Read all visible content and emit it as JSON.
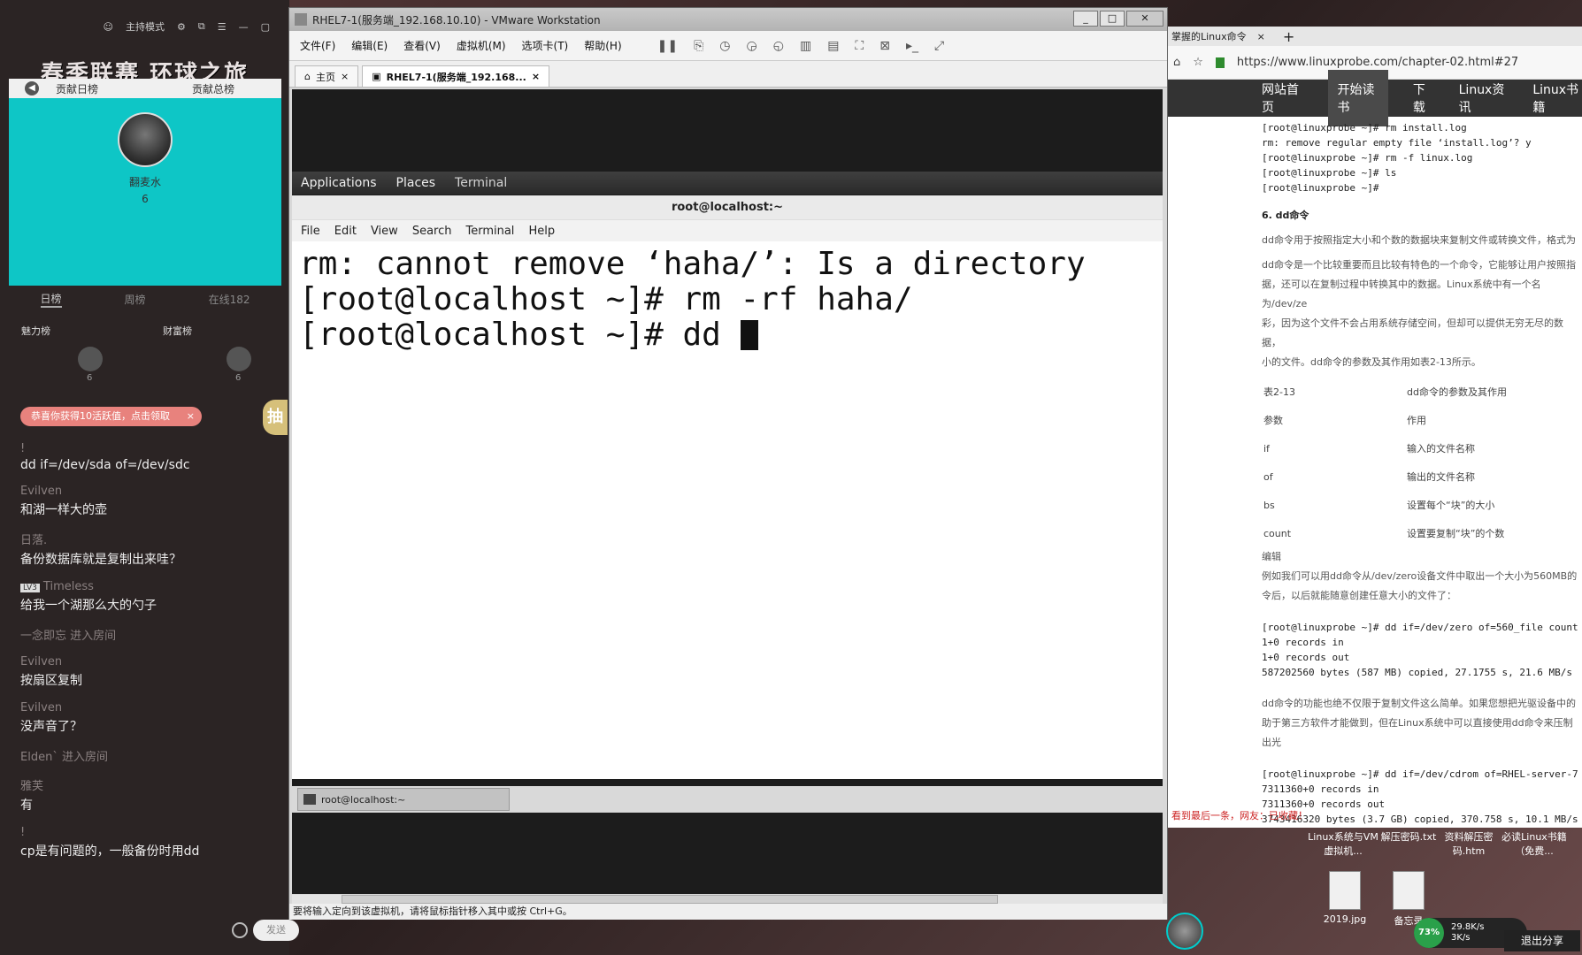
{
  "stream": {
    "topbar": {
      "host_mode": "主持模式"
    },
    "banner": "春季联赛 环球之旅",
    "rank_tabs": [
      "贡献日榜",
      "贡献总榜"
    ],
    "top_user": {
      "name": "翻麦水",
      "score": "6"
    },
    "sub_tabs": [
      "日榜",
      "周榜",
      "在线182"
    ],
    "boards": {
      "charm": "魅力榜",
      "wealth": "财富榜",
      "u1_score": "6",
      "u2_score": "6"
    },
    "notice": "恭喜你获得10活跃值，点击领取",
    "draw_label": "抽",
    "chat": [
      {
        "user": "!",
        "text": "dd if=/dev/sda of=/dev/sdc"
      },
      {
        "user": "Evilven",
        "text": "和湖一样大的壶"
      },
      {
        "user": "日落.",
        "text": "备份数据库就是复制出来哇？"
      },
      {
        "user": "Timeless",
        "badge": "LV3",
        "text": "给我一个湖那么大的勺子"
      },
      {
        "enter": "一念即忘 进入房间"
      },
      {
        "user": "Evilven",
        "text": "按扇区复制"
      },
      {
        "user": "Evilven",
        "text": "没声音了？"
      },
      {
        "enter": "Elden` 进入房间"
      },
      {
        "user": "雅芙",
        "text": "有"
      },
      {
        "user": "!",
        "text": "cp是有问题的，一般备份时用dd"
      }
    ],
    "bottom_pill": "发送"
  },
  "vmware": {
    "title": "RHEL7-1(服务端_192.168.10.10) - VMware Workstation",
    "menus": [
      "文件(F)",
      "编辑(E)",
      "查看(V)",
      "虚拟机(M)",
      "选项卡(T)",
      "帮助(H)"
    ],
    "tabs": [
      "主页",
      "RHEL7-1(服务端_192.168..."
    ],
    "status": "要将输入定向到该虚拟机，请将鼠标指针移入其中或按 Ctrl+G。"
  },
  "gnome": {
    "applications": "Applications",
    "places": "Places",
    "terminal": "Terminal"
  },
  "terminal": {
    "title": "root@localhost:~",
    "menus": [
      "File",
      "Edit",
      "View",
      "Search",
      "Terminal",
      "Help"
    ],
    "lines": [
      "rm: cannot remove ‘haha/’: Is a directory",
      "[root@localhost ~]# rm -rf haha/",
      "[root@localhost ~]# dd "
    ],
    "taskbar_item": "root@localhost:~"
  },
  "browser": {
    "tab_title": "掌握的Linux命令",
    "url": "https://www.linuxprobe.com/chapter-02.html#27",
    "nav": [
      "网站首页",
      "开始读书",
      "下载",
      "Linux资讯",
      "Linux书籍"
    ],
    "code1": [
      "[root@linuxprobe ~]# rm install.log",
      "rm: remove regular empty file ‘install.log’? y",
      "[root@linuxprobe ~]# rm -f linux.log",
      "[root@linuxprobe ~]# ls",
      "[root@linuxprobe ~]#"
    ],
    "heading": "6. dd命令",
    "para1": "dd命令用于按照指定大小和个数的数据块来复制文件或转换文件，格式为",
    "para2": [
      "dd命令是一个比较重要而且比较有特色的一个命令，它能够让用户按照指",
      "据，还可以在复制过程中转换其中的数据。Linux系统中有一个名为/dev/ze",
      "彩，因为这个文件不会占用系统存储空间，但却可以提供无穷无尽的数据，",
      "小的文件。dd命令的参数及其作用如表2-13所示。"
    ],
    "table_caption": [
      "表2-13",
      "dd命令的参数及其作用"
    ],
    "table_header": [
      "参数",
      "作用"
    ],
    "table_rows": [
      [
        "if",
        "输入的文件名称"
      ],
      [
        "of",
        "输出的文件名称"
      ],
      [
        "bs",
        "设置每个“块”的大小"
      ],
      [
        "count",
        "设置要复制“块”的个数"
      ]
    ],
    "edit": "编辑",
    "para3": [
      "例如我们可以用dd命令从/dev/zero设备文件中取出一个大小为560MB的",
      "令后，以后就能随意创建任意大小的文件了："
    ],
    "code2": [
      "[root@linuxprobe ~]# dd if=/dev/zero of=560_file count",
      "1+0 records in",
      "1+0 records out",
      "587202560 bytes (587 MB) copied, 27.1755 s, 21.6 MB/s"
    ],
    "para4": [
      "dd命令的功能也绝不仅限于复制文件这么简单。如果您想把光驱设备中的",
      "助于第三方软件才能做到，但在Linux系统中可以直接使用dd命令来压制出光"
    ],
    "code3": [
      "[root@linuxprobe ~]# dd if=/dev/cdrom of=RHEL-server-7",
      "7311360+0 records in",
      "7311360+0 records out",
      "3743416320 bytes (3.7 GB) copied, 370.758 s, 10.1 MB/s"
    ],
    "bottom_note": "看到最后一条，网友：已收藏！"
  },
  "desktop_icons": [
    {
      "label": "Linux系统与VM虚拟机..."
    },
    {
      "label": "解压密码.txt"
    },
    {
      "label": "资料解压密码.htm"
    },
    {
      "label": "必读Linux书籍（免费..."
    },
    {
      "label": "2019.jpg"
    },
    {
      "label": "备忘录"
    }
  ],
  "net": {
    "percent": "73%",
    "up": "29.8K/s",
    "down": "3K/s"
  },
  "share": "退出分享"
}
